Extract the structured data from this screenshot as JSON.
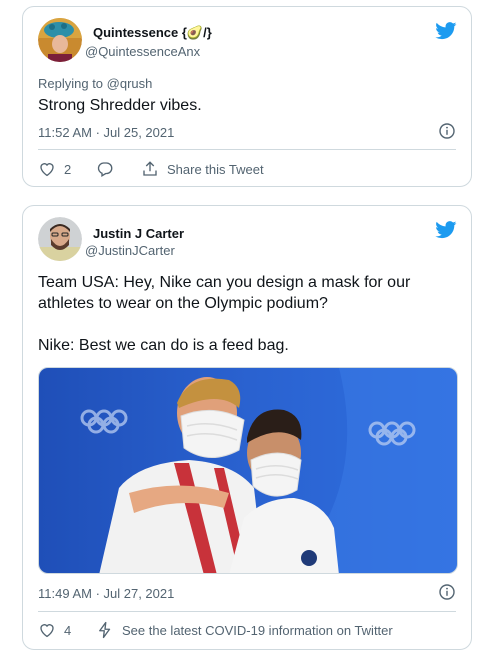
{
  "tweets": [
    {
      "name": "Quintessence {🥑/}",
      "handle": "@QuintessenceAnx",
      "replying_prefix": "Replying to ",
      "replying_to": "@qrush",
      "text": "Strong Shredder vibes.",
      "time": "11:52 AM · Jul 25, 2021",
      "likes": "2",
      "share_label": "Share this Tweet"
    },
    {
      "name": "Justin J Carter",
      "handle": "@JustinJCarter",
      "text": "Team USA: Hey, Nike can you design a mask for our athletes to wear on the Olympic podium?\n\nNike: Best we can do is a feed bag.",
      "time": "11:49 AM · Jul 27, 2021",
      "likes": "4",
      "covid_label": "See the latest COVID-19 information on Twitter"
    }
  ],
  "colors": {
    "twitter_blue": "#1d9bf0",
    "muted": "#536471",
    "border": "#cfd9de"
  },
  "icons": [
    "twitter-bird-icon",
    "info-icon",
    "heart-icon",
    "reply-icon",
    "share-icon",
    "lightning-icon"
  ]
}
